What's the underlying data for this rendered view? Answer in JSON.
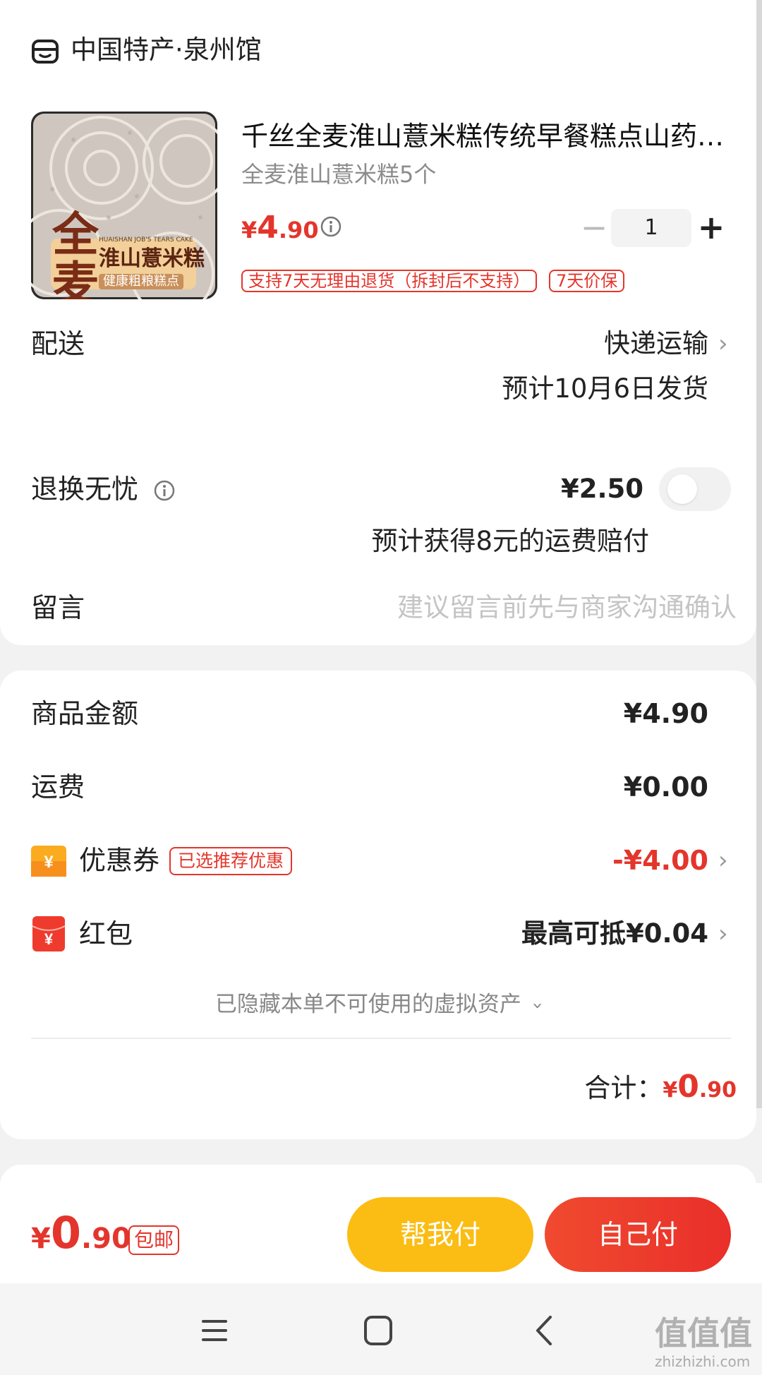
{
  "store": {
    "name": "中国特产·泉州馆",
    "icon": "store-icon"
  },
  "product": {
    "title": "千丝全麦淮山薏米糕传统早餐糕点山药…",
    "spec": "全麦淮山薏米糕5个",
    "price": {
      "currency": "¥",
      "int": "4",
      "dec": ".90"
    },
    "quantity": "1",
    "minus": "−",
    "plus": "+",
    "tags": [
      "支持7天无理由退货（拆封后不支持）",
      "7天价保"
    ],
    "image": {
      "big_text": "全麦",
      "name_text": "淮山薏米糕",
      "en_text": "HUAISHAN JOB'S TEARS CAKE",
      "sub_text": "健康粗粮糕点"
    }
  },
  "delivery": {
    "label": "配送",
    "method": "快递运输",
    "estimate": "预计10月6日发货"
  },
  "return_insurance": {
    "label": "退换无忧",
    "price": "¥2.50",
    "desc": "预计获得8元的运费赔付",
    "enabled": false
  },
  "message": {
    "label": "留言",
    "placeholder": "建议留言前先与商家沟通确认"
  },
  "summary": {
    "goods_label": "商品金额",
    "goods_value": "¥4.90",
    "shipping_label": "运费",
    "shipping_value": "¥0.00",
    "coupon_label": "优惠券",
    "coupon_badge": "已选推荐优惠",
    "coupon_value": "-¥4.00",
    "redpack_label": "红包",
    "redpack_value": "最高可抵¥0.04",
    "hidden_assets": "已隐藏本单不可使用的虚拟资产",
    "total_label": "合计：",
    "total_price": {
      "currency": "¥",
      "int": "0",
      "dec": ".90"
    }
  },
  "bottom_bar": {
    "price": {
      "currency": "¥",
      "int": "0",
      "dec": ".90"
    },
    "badge": "包邮",
    "help_pay": "帮我付",
    "self_pay": "自己付"
  },
  "watermark": {
    "main": "值值值",
    "sub": "zhizhizhi.com"
  },
  "colors": {
    "accent_red": "#e4352c",
    "yellow_button": "#fbbd14",
    "red_button": "#ee3e2d"
  }
}
